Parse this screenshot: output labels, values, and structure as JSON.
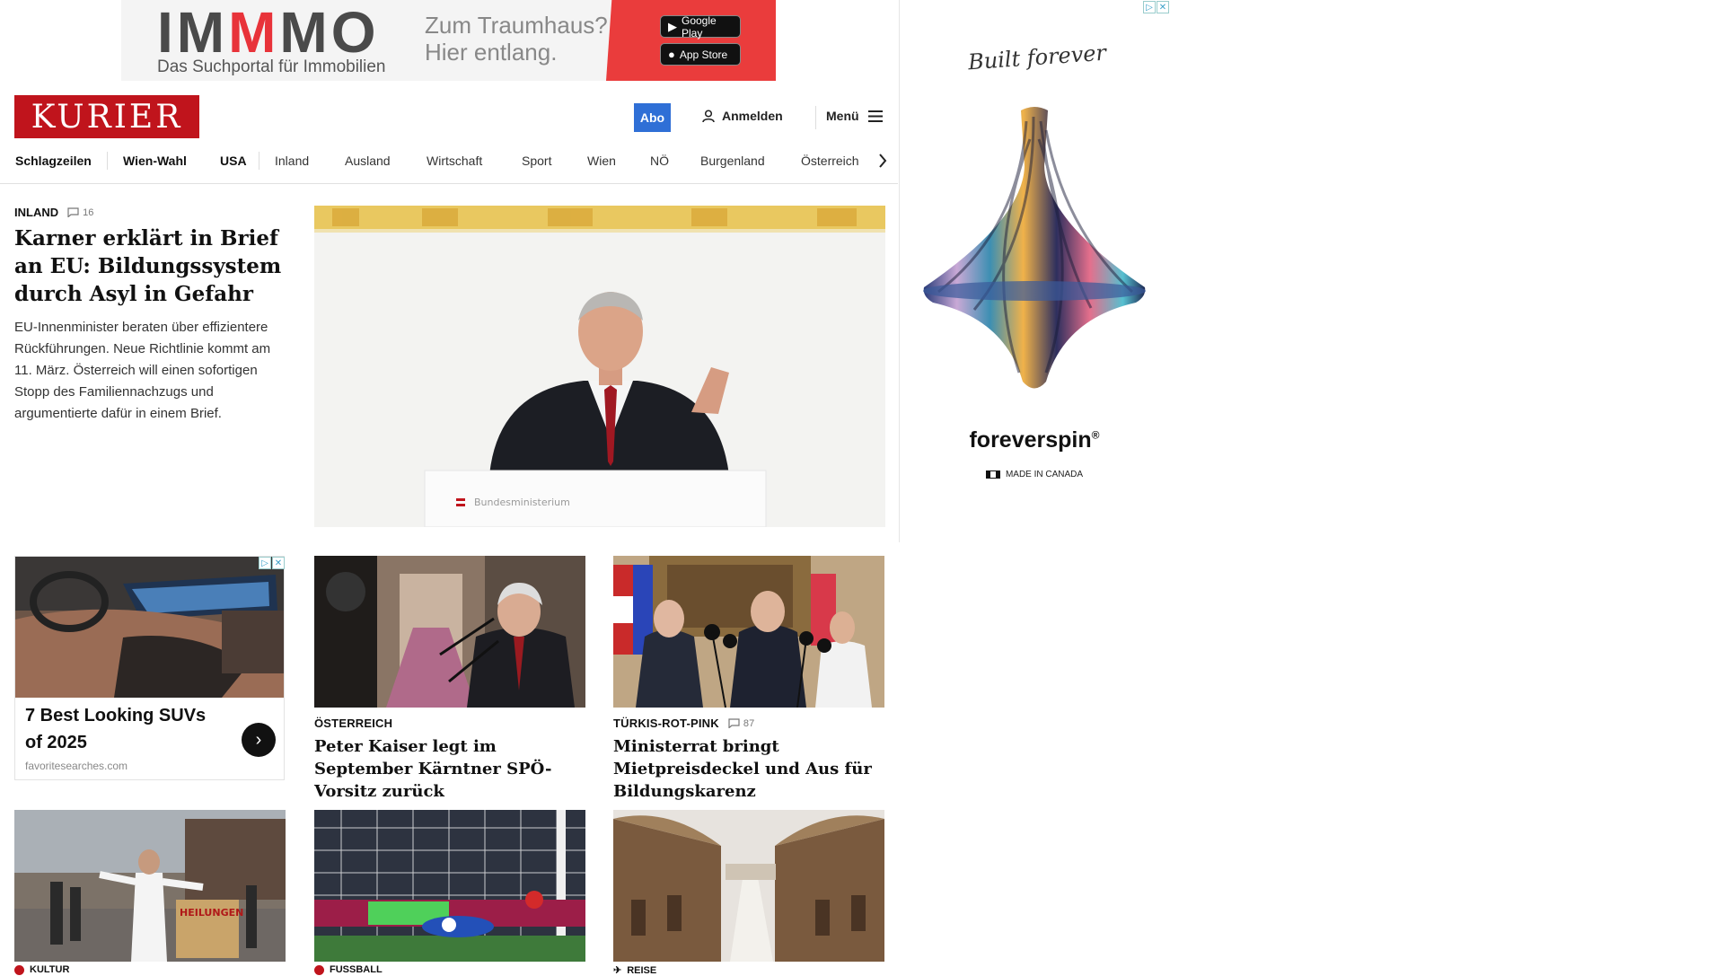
{
  "banner": {
    "logo_left": "IM",
    "logo_red": "M",
    "logo_right": "MO",
    "subtitle": "Das Suchportal für Immobilien",
    "slogan_line1": "Zum Traumhaus?",
    "slogan_line2": "Hier entlang.",
    "google_play": "Google Play",
    "app_store": "App Store"
  },
  "header": {
    "logo": "KURIER",
    "abo": "Abo",
    "login": "Anmelden",
    "menu": "Menü"
  },
  "nav": {
    "items": [
      "Schlagzeilen",
      "Wien-Wahl",
      "USA",
      "Inland",
      "Ausland",
      "Wirtschaft",
      "Sport",
      "Wien",
      "NÖ",
      "Burgenland",
      "Österreich"
    ]
  },
  "lead": {
    "kicker": "INLAND",
    "comments": "16",
    "title": "Karner erklärt in Brief an EU: Bildungssystem durch Asyl in Gefahr",
    "teaser": "EU-Innenminister beraten über effizientere Rückführungen. Neue Richtlinie kommt am 11. März. Österreich will einen sofortigen Stopp des Familiennachzugs und argumentierte dafür in einem Brief.",
    "lectern_text": "Bundesministerium"
  },
  "ad_card": {
    "title": "7 Best Looking SUVs of 2025",
    "source": "favoritesearches.com"
  },
  "cards": [
    {
      "kicker": "ÖSTERREICH",
      "title": "Peter Kaiser legt im September Kärntner SPÖ-Vorsitz zurück"
    },
    {
      "kicker": "TÜRKIS-ROT-PINK",
      "comments": "87",
      "title": "Ministerrat bringt Mietpreisdeckel und Aus für Bildungskarenz"
    }
  ],
  "row2": {
    "kickers": [
      "KULTUR",
      "FUSSBALL",
      "REISE"
    ],
    "sign_text": "HEILUNGEN"
  },
  "side_ad": {
    "script": "Built forever",
    "brand": "foreverspin",
    "reg": "®",
    "made": "MADE IN CANADA"
  },
  "colors": {
    "kurier_red": "#c0141c",
    "abo_blue": "#2f6fd6",
    "immmo_red": "#e8333a"
  }
}
